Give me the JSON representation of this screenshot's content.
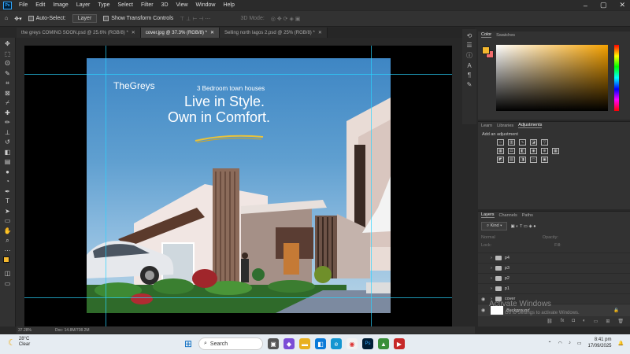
{
  "app": {
    "logo": "Ps"
  },
  "menu": [
    "File",
    "Edit",
    "Image",
    "Layer",
    "Type",
    "Select",
    "Filter",
    "3D",
    "View",
    "Window",
    "Help"
  ],
  "options_bar": {
    "auto_select": "Auto-Select:",
    "target": "Layer",
    "transform": "Show Transform Controls",
    "mode3d": "3D Mode:"
  },
  "tabs": [
    {
      "label": "the greys COMING SOON.psd @ 25.6% (RGB/8) *",
      "active": false
    },
    {
      "label": "cover.jpg @ 37.3% (RGB/8) *",
      "active": true
    },
    {
      "label": "Selling north lagos 2.psd @ 25% (RGB/8) *",
      "active": false
    }
  ],
  "artwork": {
    "brand": "TheGreys",
    "subtitle": "3 Bedroom town houses",
    "headline1": "Live in Style.",
    "headline2": "Own in Comfort."
  },
  "status": {
    "zoom": "37.28%",
    "doc": "Doc: 14.8M/708.2M"
  },
  "color_panel": {
    "tabs": [
      "Color",
      "Swatches"
    ],
    "fg": "#f5b82e",
    "bg": "#f26d6d"
  },
  "adjustments": {
    "tabs": [
      "Learn",
      "Libraries",
      "Adjustments"
    ],
    "label": "Add an adjustment"
  },
  "layers_panel": {
    "tabs": [
      "Layers",
      "Channels",
      "Paths"
    ],
    "filter": "Kind",
    "blend": "Normal",
    "opacity_label": "Opacity:",
    "lock_label": "Lock:",
    "fill_label": "Fill:",
    "layers": [
      "p4",
      "p3",
      "p2",
      "p1",
      "cover",
      "Background"
    ]
  },
  "watermark": {
    "title": "Activate Windows",
    "sub": "Go to Settings to activate Windows."
  },
  "taskbar": {
    "temp": "28°C",
    "weather": "Clear",
    "search": "Search",
    "time": "8:41 pm",
    "date": "17/09/2025"
  }
}
